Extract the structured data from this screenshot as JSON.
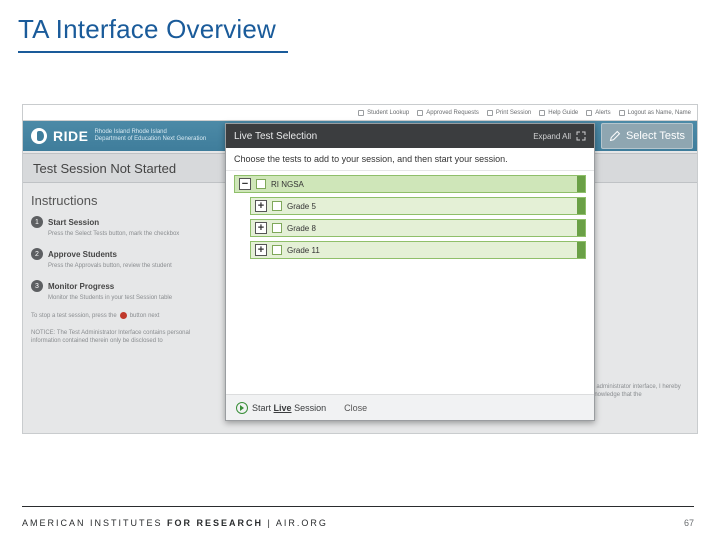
{
  "slide": {
    "title": "TA Interface Overview"
  },
  "topbar": {
    "items": [
      "Student Lookup",
      "Approved Requests",
      "Print Session",
      "Help Guide",
      "Alerts",
      "Logout as Name, Name"
    ]
  },
  "appbar": {
    "brand": "RIDE",
    "sub1": "Rhode Island   Rhode Island",
    "sub2": "Department of Education   Next Generation",
    "select_tests": "Select Tests"
  },
  "session": {
    "status": "Test Session Not Started"
  },
  "instructions": {
    "heading": "Instructions",
    "steps": [
      {
        "num": "1",
        "title": "Start Session",
        "body": "Press the Select Tests button, mark the checkbox"
      },
      {
        "num": "2",
        "title": "Approve Students",
        "body": "Press the Approvals button, review the student"
      },
      {
        "num": "3",
        "title": "Monitor Progress",
        "body": "Monitor the Students in your test Session table"
      }
    ],
    "stop_pre": "To stop a test session, press the",
    "stop_post": "button next",
    "notice_left": "NOTICE: The Test Administrator Interface contains personal information contained therein only be disclosed to",
    "notice_right": "test administrator interface, I hereby acknowledge that the"
  },
  "modal": {
    "title": "Live Test Selection",
    "expand_all": "Expand All",
    "subtitle": "Choose the tests to add to your session, and then start your session.",
    "tree": [
      {
        "label": "RI NGSA",
        "children": [
          {
            "label": "Grade 5"
          },
          {
            "label": "Grade 8"
          },
          {
            "label": "Grade 11"
          }
        ]
      }
    ],
    "start_pre": "Start",
    "start_bold": "Live",
    "start_post": "Session",
    "close": "Close"
  },
  "footer": {
    "org1": "AMERICAN INSTITUTES ",
    "org2": "FOR RESEARCH",
    "sep": " | ",
    "site": "AIR.ORG",
    "page": "67"
  }
}
